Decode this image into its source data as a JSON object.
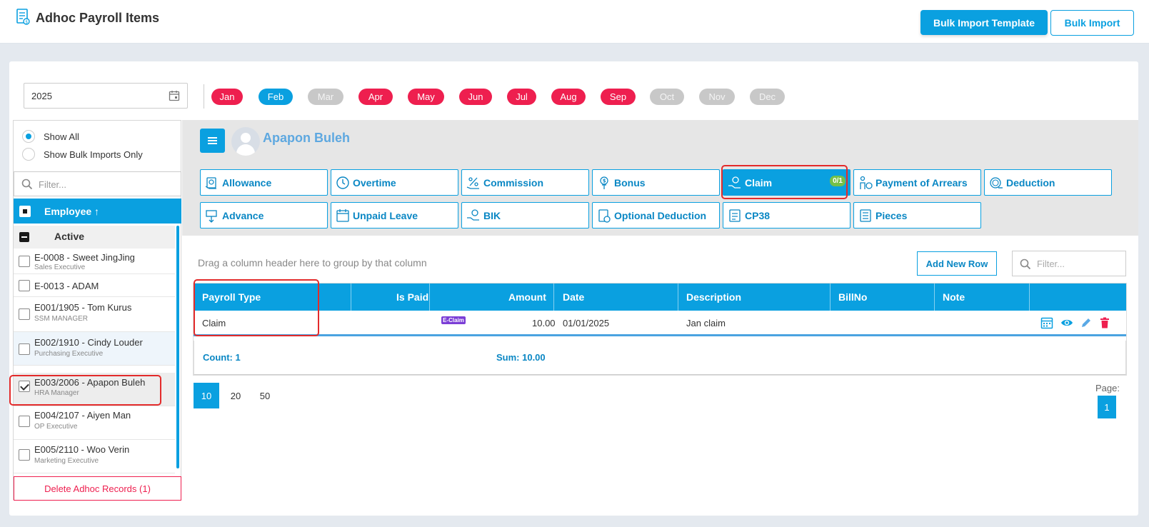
{
  "header": {
    "title": "Adhoc Payroll Items",
    "bulk_template_label": "Bulk Import Template",
    "bulk_import_label": "Bulk Import"
  },
  "year": "2025",
  "months": [
    {
      "label": "Jan",
      "status": "red"
    },
    {
      "label": "Feb",
      "status": "blue"
    },
    {
      "label": "Mar",
      "status": "grey"
    },
    {
      "label": "Apr",
      "status": "red"
    },
    {
      "label": "May",
      "status": "red"
    },
    {
      "label": "Jun",
      "status": "red"
    },
    {
      "label": "Jul",
      "status": "red"
    },
    {
      "label": "Aug",
      "status": "red"
    },
    {
      "label": "Sep",
      "status": "red"
    },
    {
      "label": "Oct",
      "status": "grey"
    },
    {
      "label": "Nov",
      "status": "grey"
    },
    {
      "label": "Dec",
      "status": "grey"
    }
  ],
  "sidebar": {
    "show_all_label": "Show All",
    "show_bulk_label": "Show Bulk Imports Only",
    "filter_placeholder": "Filter...",
    "employee_header": "Employee",
    "sort_icon": "↑",
    "group_label": "Active",
    "employees": [
      {
        "name": "E-0008 - Sweet JingJing",
        "position": "Sales Executive",
        "checked": false
      },
      {
        "name": "E-0013 - ADAM",
        "position": "",
        "checked": false
      },
      {
        "name": "E001/1905 - Tom Kurus",
        "position": "SSM MANAGER",
        "checked": false
      },
      {
        "name": "E002/1910 - Cindy Louder",
        "position": "Purchasing Executive",
        "checked": false
      },
      {
        "name": "E003/2006 - Apapon Buleh",
        "position": "HRA Manager",
        "checked": true
      },
      {
        "name": "E004/2107 - Aiyen Man",
        "position": "OP Executive",
        "checked": false
      },
      {
        "name": "E005/2110 - Woo Verin",
        "position": "Marketing Executive",
        "checked": false
      }
    ],
    "delete_label": "Delete Adhoc Records (1)"
  },
  "employee_name": "Apapon Buleh",
  "tabs": [
    {
      "label": "Allowance",
      "icon": "allowance-icon"
    },
    {
      "label": "Overtime",
      "icon": "clock-icon"
    },
    {
      "label": "Commission",
      "icon": "percent-icon"
    },
    {
      "label": "Bonus",
      "icon": "money-bag-icon"
    },
    {
      "label": "Claim",
      "icon": "claim-hand-icon",
      "active": true,
      "badge": "0/1"
    },
    {
      "label": "Payment of Arrears",
      "icon": "person-coin-icon"
    },
    {
      "label": "Deduction",
      "icon": "coin-minus-icon"
    },
    {
      "label": "Advance",
      "icon": "advance-icon"
    },
    {
      "label": "Unpaid Leave",
      "icon": "calendar-icon"
    },
    {
      "label": "BIK",
      "icon": "hand-coin-icon"
    },
    {
      "label": "Optional Deduction",
      "icon": "document-coin-icon"
    },
    {
      "label": "CP38",
      "icon": "form-icon"
    },
    {
      "label": "Pieces",
      "icon": "list-icon"
    }
  ],
  "grid": {
    "drag_hint": "Drag a column header here to group by that column",
    "add_row_label": "Add New Row",
    "filter_placeholder": "Filter...",
    "columns": [
      "Payroll Type",
      "Is Paid",
      "Amount",
      "Date",
      "Description",
      "BillNo",
      "Note"
    ],
    "rows": [
      {
        "payroll_type": "Claim",
        "is_paid": "",
        "badge": "E-Claim",
        "amount": "10.00",
        "date": "01/01/2025",
        "description": "Jan claim",
        "billno": "",
        "note": ""
      }
    ],
    "count_label": "Count: 1",
    "sum_label": "Sum: 10.00",
    "page_sizes": [
      "10",
      "20",
      "50"
    ],
    "page_label": "Page:",
    "current_page": "1"
  },
  "colors": {
    "primary": "#0aa0e0",
    "danger": "#ee1f4f",
    "disabled": "#c8c8c8",
    "badge_green": "#74c04a",
    "eclaim_purple": "#7b3ed6",
    "highlight": "#e32b2b"
  }
}
